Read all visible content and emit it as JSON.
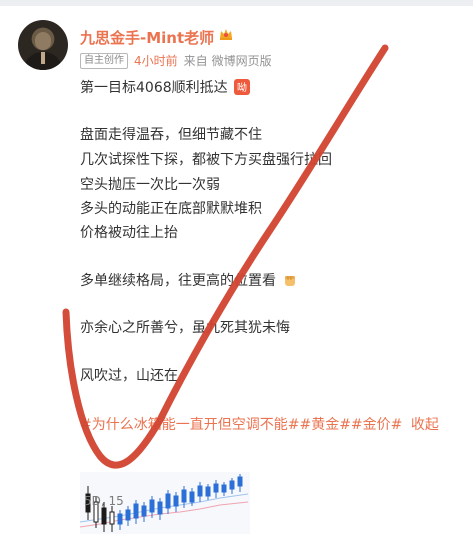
{
  "post": {
    "username": "九思金手-Mint老师",
    "badge": "自主创作",
    "time": "4小时前",
    "from_label": "来自",
    "source": "微博网页版",
    "lines": [
      "第一目标4068顺利抵达",
      "盘面走得温吞，但细节藏不住",
      "几次试探性下探，都被下方买盘强行拉回",
      "空头抛压一次比一次弱",
      "多头的动能正在底部默默堆积",
      "价格被动往上抬",
      "多单继续格局，往更高的位置看",
      "亦余心之所善兮，虽九死其犹未悔",
      "风吹过，山还在"
    ],
    "tags": "#为什么冰箱能一直开但空调不能##黄金##金价#",
    "collapse_label": "收起",
    "thumb_label": "5D, 15"
  },
  "icons": {
    "crown": "crown-icon",
    "laugh": "laugh-emoji-icon",
    "fist": "fist-emoji-icon"
  },
  "colors": {
    "accent": "#eb7350",
    "text": "#333333",
    "meta": "#939393",
    "annotation_red": "#d1432f"
  }
}
